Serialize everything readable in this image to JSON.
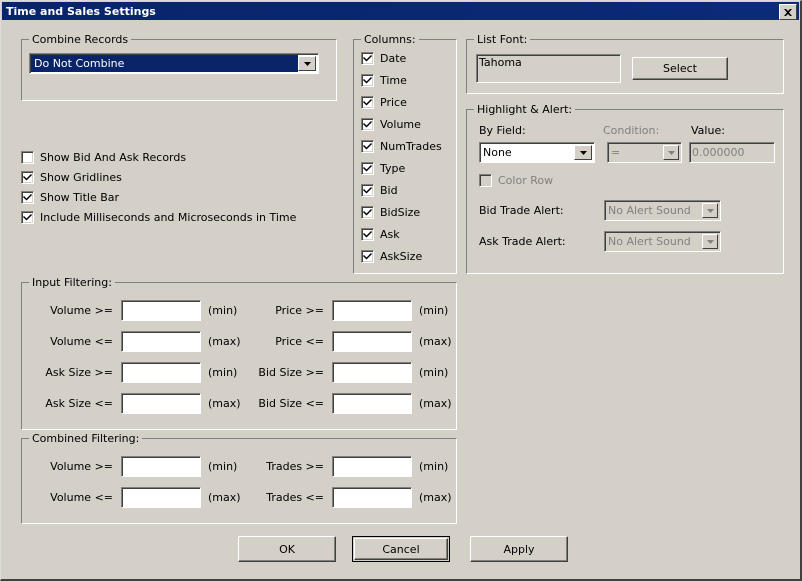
{
  "window": {
    "title": "Time and Sales Settings",
    "close_icon": "close-icon",
    "accent_color": "#0a246a",
    "face_color": "#d4d0c8"
  },
  "combine_records": {
    "legend": "Combine Records",
    "selected": "Do Not Combine"
  },
  "general_options": [
    {
      "label": "Show Bid And Ask Records",
      "checked": false
    },
    {
      "label": "Show Gridlines",
      "checked": true
    },
    {
      "label": "Show Title Bar",
      "checked": true
    },
    {
      "label": "Include Milliseconds and Microseconds in Time",
      "checked": true
    }
  ],
  "columns": {
    "legend": "Columns:",
    "items": [
      {
        "label": "Date",
        "checked": true
      },
      {
        "label": "Time",
        "checked": true
      },
      {
        "label": "Price",
        "checked": true
      },
      {
        "label": "Volume",
        "checked": true
      },
      {
        "label": "NumTrades",
        "checked": true
      },
      {
        "label": "Type",
        "checked": true
      },
      {
        "label": "Bid",
        "checked": true
      },
      {
        "label": "BidSize",
        "checked": true
      },
      {
        "label": "Ask",
        "checked": true
      },
      {
        "label": "AskSize",
        "checked": true
      }
    ]
  },
  "list_font": {
    "legend": "List Font:",
    "value": "Tahoma",
    "select_label": "Select"
  },
  "highlight_alert": {
    "legend": "Highlight & Alert:",
    "by_field_label": "By Field:",
    "by_field_value": "None",
    "condition_label": "Condition:",
    "condition_value": "=",
    "value_label": "Value:",
    "value_value": "0.000000",
    "color_row_label": "Color Row",
    "color_row_checked": false,
    "bid_trade_alert_label": "Bid Trade Alert:",
    "bid_trade_alert_value": "No Alert Sound",
    "ask_trade_alert_label": "Ask Trade Alert:",
    "ask_trade_alert_value": "No Alert Sound"
  },
  "input_filtering": {
    "legend": "Input Filtering:",
    "rows": [
      {
        "left_label": "Volume >=",
        "left_value": "",
        "left_hint": "(min)",
        "right_label": "Price >=",
        "right_value": "",
        "right_hint": "(min)"
      },
      {
        "left_label": "Volume <=",
        "left_value": "",
        "left_hint": "(max)",
        "right_label": "Price <=",
        "right_value": "",
        "right_hint": "(max)"
      },
      {
        "left_label": "Ask Size >=",
        "left_value": "",
        "left_hint": "(min)",
        "right_label": "Bid Size >=",
        "right_value": "",
        "right_hint": "(min)"
      },
      {
        "left_label": "Ask Size <=",
        "left_value": "",
        "left_hint": "(max)",
        "right_label": "Bid Size <=",
        "right_value": "",
        "right_hint": "(max)"
      }
    ]
  },
  "combined_filtering": {
    "legend": "Combined Filtering:",
    "rows": [
      {
        "left_label": "Volume >=",
        "left_value": "",
        "left_hint": "(min)",
        "right_label": "Trades >=",
        "right_value": "",
        "right_hint": "(min)"
      },
      {
        "left_label": "Volume <=",
        "left_value": "",
        "left_hint": "(max)",
        "right_label": "Trades <=",
        "right_value": "",
        "right_hint": "(max)"
      }
    ]
  },
  "buttons": {
    "ok": "OK",
    "cancel": "Cancel",
    "apply": "Apply"
  }
}
